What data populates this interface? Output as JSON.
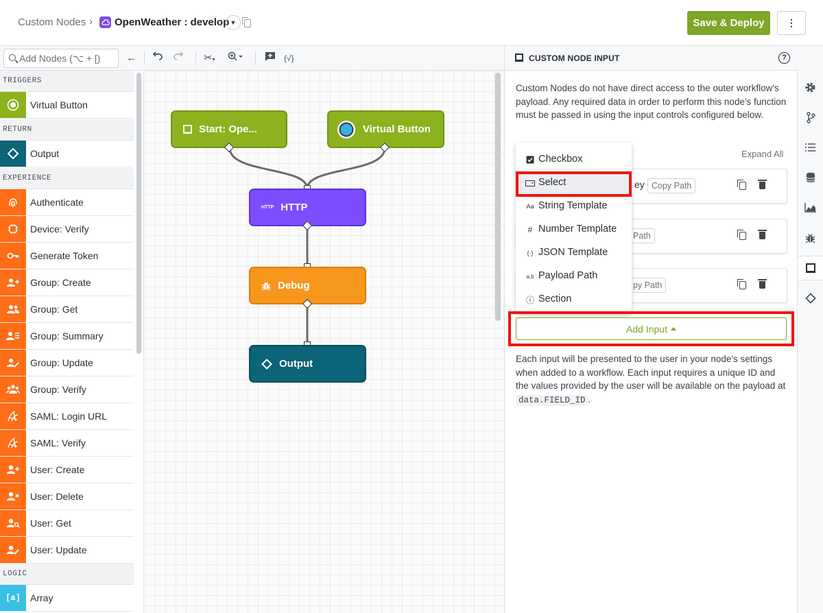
{
  "header": {
    "breadcrumb_root": "Custom Nodes",
    "breadcrumb_sep": "›",
    "app_name": "OpenWeather : develop",
    "save_label": "Save & Deploy",
    "more_label": "⋮"
  },
  "toolbar": {
    "search_placeholder": "Add Nodes (⌥ + [)",
    "json_label": "{√}"
  },
  "palette": {
    "sections": {
      "triggers": "TRIGGERS",
      "return": "RETURN",
      "experience": "EXPERIENCE",
      "logic": "LOGIC"
    },
    "items": {
      "virtual_button": "Virtual Button",
      "output": "Output",
      "authenticate": "Authenticate",
      "device_verify": "Device: Verify",
      "generate_token": "Generate Token",
      "group_create": "Group: Create",
      "group_get": "Group: Get",
      "group_summary": "Group: Summary",
      "group_update": "Group: Update",
      "group_verify": "Group: Verify",
      "saml_login_url": "SAML: Login URL",
      "saml_verify": "SAML: Verify",
      "user_create": "User: Create",
      "user_delete": "User: Delete",
      "user_get": "User: Get",
      "user_update": "User: Update",
      "array": "Array"
    }
  },
  "canvas": {
    "nodes": {
      "start": "Start: Ope...",
      "virtual_button": "Virtual Button",
      "http": "HTTP",
      "http_icon": "HTTP",
      "debug": "Debug",
      "output": "Output"
    }
  },
  "panel": {
    "title": "CUSTOM NODE INPUT",
    "description": "Custom Nodes do not have direct access to the outer workflow's payload. Any required data in order to perform this node's function must be passed in using the input controls configured below.",
    "expand_all": "Expand All",
    "cards": [
      {
        "fragment": "ey",
        "copy_path": "Copy Path"
      },
      {
        "fragment": "",
        "copy_path": "Path"
      },
      {
        "fragment": "",
        "copy_path": "py Path"
      }
    ],
    "dropdown": [
      {
        "icon": "checkbox-icon",
        "glyph": "☑",
        "label": "Checkbox"
      },
      {
        "icon": "select-icon",
        "glyph": "▭",
        "label": "Select"
      },
      {
        "icon": "string-template-icon",
        "glyph": "Aa",
        "label": "String Template"
      },
      {
        "icon": "number-template-icon",
        "glyph": "#",
        "label": "Number Template"
      },
      {
        "icon": "json-template-icon",
        "glyph": "{·}",
        "label": "JSON Template"
      },
      {
        "icon": "payload-path-icon",
        "glyph": "a.b",
        "label": "Payload Path"
      },
      {
        "icon": "section-icon",
        "glyph": "ⓘ",
        "label": "Section"
      }
    ],
    "add_input_label": "Add Input",
    "footer_text_before": "Each input will be presented to the user in your node's settings when added to a workflow. Each input requires a unique ID and the values provided by the user will be available on the payload at ",
    "footer_code": "data.FIELD_ID",
    "footer_text_after": "."
  },
  "colors": {
    "accent": "#7ea628",
    "trigger_green": "#8cb21d",
    "http_purple": "#7b4dff",
    "debug_orange": "#f7961d",
    "output_teal": "#0b6477",
    "experience_orange": "#ff6d17",
    "logic_cyan": "#3bbfe5",
    "highlight_red": "#f2140f"
  }
}
